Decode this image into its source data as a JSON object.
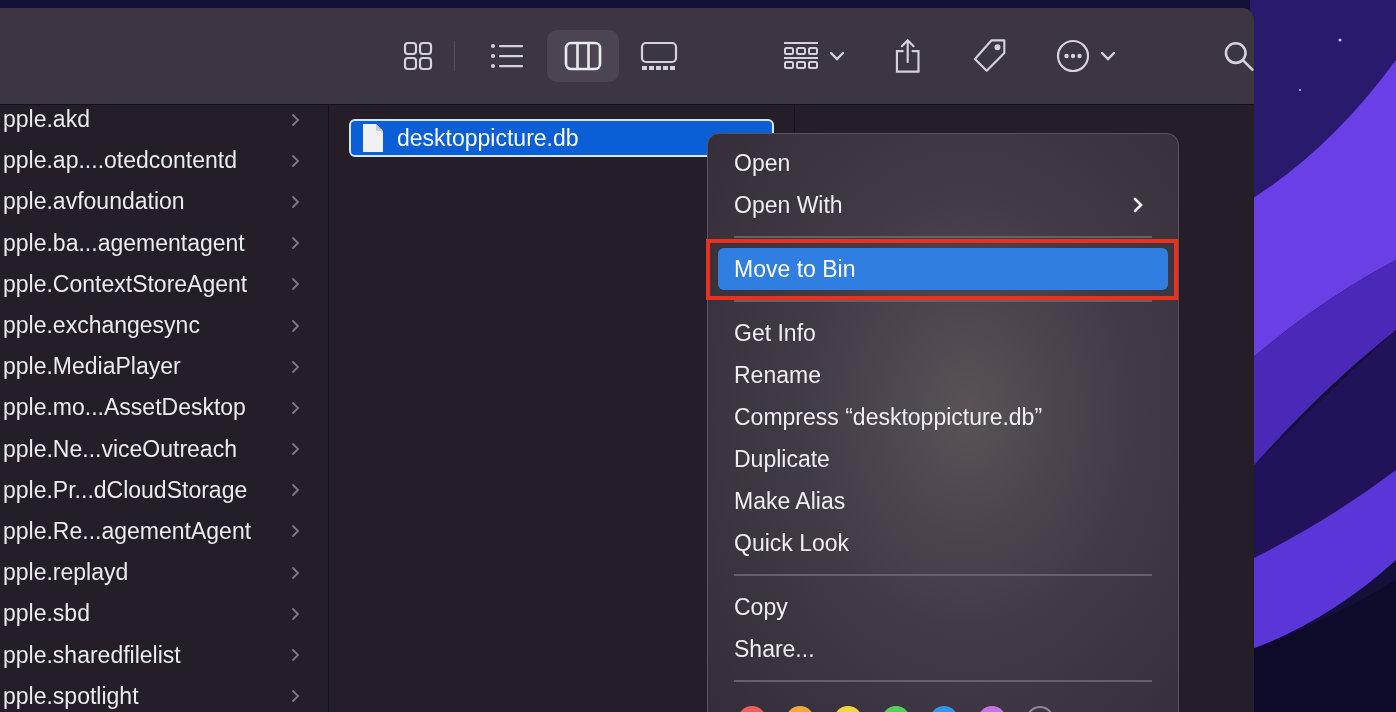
{
  "toolbar": {
    "view_buttons": [
      {
        "kind": "icons",
        "selected": false
      },
      {
        "kind": "list",
        "selected": false
      },
      {
        "kind": "columns",
        "selected": true
      },
      {
        "kind": "gallery",
        "selected": false
      }
    ]
  },
  "columns": [
    {
      "items": [
        {
          "name": "pple.akd"
        },
        {
          "name": "pple.ap....otedcontentd"
        },
        {
          "name": "pple.avfoundation"
        },
        {
          "name": "pple.ba...agementagent"
        },
        {
          "name": "pple.ContextStoreAgent"
        },
        {
          "name": "pple.exchangesync"
        },
        {
          "name": "pple.MediaPlayer"
        },
        {
          "name": "pple.mo...AssetDesktop"
        },
        {
          "name": "pple.Ne...viceOutreach"
        },
        {
          "name": "pple.Pr...dCloudStorage"
        },
        {
          "name": "pple.Re...agementAgent"
        },
        {
          "name": "pple.replayd"
        },
        {
          "name": "pple.sbd"
        },
        {
          "name": "pple.sharedfilelist"
        },
        {
          "name": "pple.spotlight"
        }
      ]
    }
  ],
  "files": [
    {
      "name": "desktoppicture.db",
      "selected": true
    }
  ],
  "context_menu": {
    "groups": [
      [
        {
          "label": "Open",
          "submenu": false,
          "selected": false,
          "annotated": false
        },
        {
          "label": "Open With",
          "submenu": true,
          "selected": false,
          "annotated": false
        }
      ],
      [
        {
          "label": "Move to Bin",
          "submenu": false,
          "selected": true,
          "annotated": true
        }
      ],
      [
        {
          "label": "Get Info",
          "submenu": false,
          "selected": false,
          "annotated": false
        },
        {
          "label": "Rename",
          "submenu": false,
          "selected": false,
          "annotated": false
        },
        {
          "label": "Compress “desktoppicture.db”",
          "submenu": false,
          "selected": false,
          "annotated": false
        },
        {
          "label": "Duplicate",
          "submenu": false,
          "selected": false,
          "annotated": false
        },
        {
          "label": "Make Alias",
          "submenu": false,
          "selected": false,
          "annotated": false
        },
        {
          "label": "Quick Look",
          "submenu": false,
          "selected": false,
          "annotated": false
        }
      ],
      [
        {
          "label": "Copy",
          "submenu": false,
          "selected": false,
          "annotated": false
        },
        {
          "label": "Share...",
          "submenu": false,
          "selected": false,
          "annotated": false
        }
      ]
    ],
    "tags": [
      {
        "kind": "filled",
        "color": "#ee5e5c"
      },
      {
        "kind": "filled",
        "color": "#f3a93a"
      },
      {
        "kind": "filled",
        "color": "#f2d63a"
      },
      {
        "kind": "filled",
        "color": "#4fd15c"
      },
      {
        "kind": "filled",
        "color": "#2f96ee"
      },
      {
        "kind": "filled",
        "color": "#c474e6"
      },
      {
        "kind": "outline",
        "color": "#8e8991"
      }
    ]
  }
}
